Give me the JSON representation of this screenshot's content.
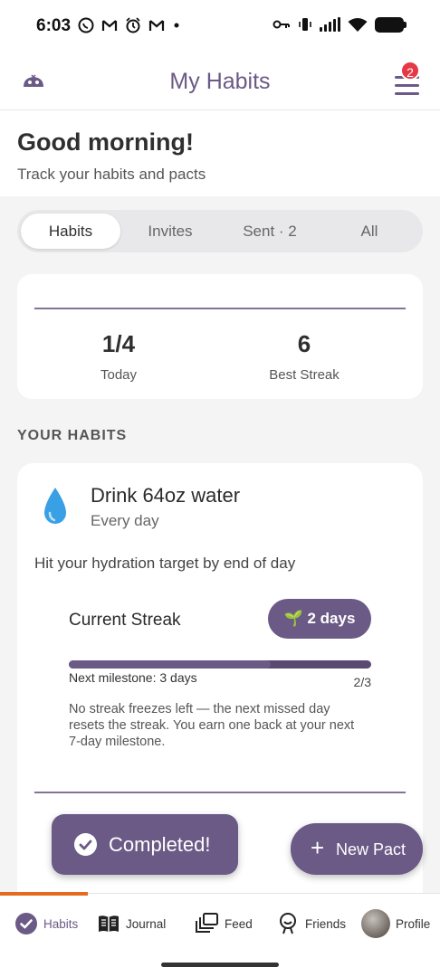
{
  "status_bar": {
    "time": "6:03",
    "left_icons": [
      "whatsapp-icon",
      "gmail-icon",
      "alarm-icon",
      "gmail-icon",
      "dot-icon"
    ],
    "right_icons": [
      "vpn-key-icon",
      "vibrate-icon",
      "signal-icon",
      "wifi-icon",
      "battery-icon"
    ]
  },
  "header": {
    "title": "My Habits",
    "menu_badge": "2"
  },
  "greeting": {
    "title": "Good morning!",
    "subtitle": "Track your habits and pacts"
  },
  "tabs": [
    {
      "label": "Habits",
      "active": true
    },
    {
      "label": "Invites",
      "active": false
    },
    {
      "label": "Sent · 2",
      "active": false
    },
    {
      "label": "All",
      "active": false
    }
  ],
  "stats": {
    "today_value": "1/4",
    "today_label": "Today",
    "best_value": "6",
    "best_label": "Best Streak"
  },
  "section_title": "YOUR HABITS",
  "habit": {
    "icon": "water-drop-icon",
    "name": "Drink 64oz water",
    "frequency": "Every day",
    "description": "Hit your hydration target by end of day",
    "streak_label": "Current Streak",
    "streak_badge": "🌱 2 days",
    "progress_fraction": 0.6667,
    "milestone": "Next milestone: 3 days",
    "ratio": "2/3",
    "freeze_note": "No streak freezes left — the next missed day resets the streak. You earn one back at your next 7-day milestone."
  },
  "completed_button": "Completed!",
  "new_pact_button": "New Pact",
  "bottom_nav": [
    {
      "label": "Habits",
      "icon": "check-circle-icon",
      "active": true
    },
    {
      "label": "Journal",
      "icon": "book-icon",
      "active": false
    },
    {
      "label": "Feed",
      "icon": "layers-icon",
      "active": false
    },
    {
      "label": "Friends",
      "icon": "friends-icon",
      "active": false
    },
    {
      "label": "Profile",
      "icon": "avatar",
      "active": false
    }
  ],
  "colors": {
    "accent": "#6a5a85",
    "badge": "#e53945",
    "nav_indicator": "#e46a1e",
    "water": "#3aa0e6"
  }
}
